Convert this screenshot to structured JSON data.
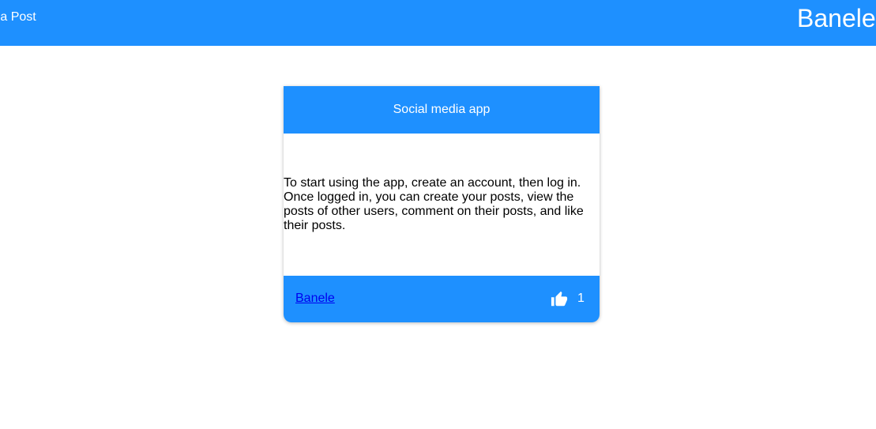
{
  "navbar": {
    "create_post_label": "e a Post",
    "username": "Banele",
    "background": "#1e90ff"
  },
  "post": {
    "title": "Social media app",
    "body": "To start using the app, create an account, then log in. Once logged in, you can create your posts, view the posts of other users, comment on their posts, and like their posts.",
    "author": "Banele",
    "like_icon": "thumbs-up-icon",
    "likes": "1"
  }
}
